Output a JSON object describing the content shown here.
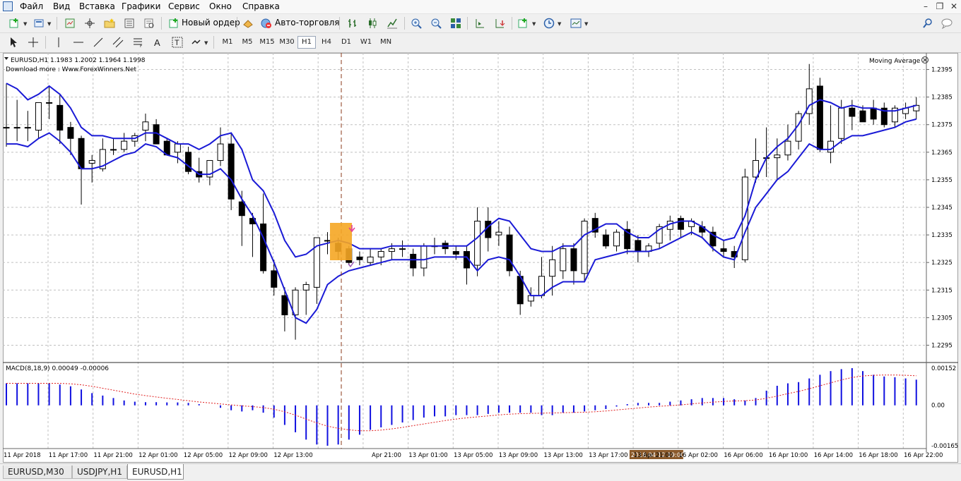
{
  "menu": {
    "items": [
      "Файл",
      "Вид",
      "Вставка",
      "Графики",
      "Сервис",
      "Окно",
      "Справка"
    ]
  },
  "toolbar": {
    "new_order_label": "Новый ордер",
    "auto_trading_label": "Авто-торговля"
  },
  "periods": [
    "M1",
    "M5",
    "M15",
    "M30",
    "H1",
    "H4",
    "D1",
    "W1",
    "MN"
  ],
  "active_period": "H1",
  "chart": {
    "header": "EURUSD,H1  1.1983 1.2002 1.1964 1.1998",
    "watermark": "Download more : Www.ForexWinners.Net",
    "indicator_label": "Moving Average",
    "price_labels": [
      "1.2395",
      "1.2385",
      "1.2375",
      "1.2365",
      "1.2355",
      "1.2345",
      "1.2335",
      "1.2325",
      "1.2315",
      "1.2305",
      "1.2295"
    ],
    "macd_label": "MACD(8,18,9) 0.00049 -0.00006",
    "macd_labels": [
      "0.00152",
      "0.00",
      "-0.00165"
    ],
    "time_labels": [
      "11 Apr 2018",
      "11 Apr 17:00",
      "11 Apr 21:00",
      "12 Apr 01:00",
      "12 Apr 05:00",
      "12 Apr 09:00",
      "12 Apr 13:00",
      "2018.04.12 19:00",
      "Apr 21:00",
      "13 Apr 01:00",
      "13 Apr 05:00",
      "13 Apr 09:00",
      "13 Apr 13:00",
      "13 Apr 17:00",
      "13 Apr 21:00",
      "16 Apr 02:00",
      "16 Apr 06:00",
      "16 Apr 10:00",
      "16 Apr 14:00",
      "16 Apr 18:00",
      "16 Apr 22:00"
    ],
    "highlighted_time": "2018.04.12 19:00",
    "colors": {
      "ma_line": "#1a1ad6",
      "macd_hist": "#1010e0",
      "macd_signal": "#e02020",
      "cursor_line": "#8b3a1a",
      "grid": "#c0c0c0",
      "signal_box": "#f5a623",
      "time_highlight_bg": "#8b5a2b"
    }
  },
  "chart_data": {
    "type": "candlestick",
    "symbol": "EURUSD",
    "timeframe": "H1",
    "ylim": [
      1.229,
      1.24
    ],
    "candles": [
      {
        "o": 1.2374,
        "h": 1.239,
        "l": 1.2367,
        "c": 1.2374
      },
      {
        "o": 1.2374,
        "h": 1.2384,
        "l": 1.2369,
        "c": 1.2374
      },
      {
        "o": 1.2374,
        "h": 1.238,
        "l": 1.2369,
        "c": 1.2374
      },
      {
        "o": 1.2373,
        "h": 1.2383,
        "l": 1.237,
        "c": 1.2383
      },
      {
        "o": 1.2383,
        "h": 1.2389,
        "l": 1.2377,
        "c": 1.2383
      },
      {
        "o": 1.2382,
        "h": 1.2386,
        "l": 1.2368,
        "c": 1.2373
      },
      {
        "o": 1.2374,
        "h": 1.2376,
        "l": 1.2364,
        "c": 1.237
      },
      {
        "o": 1.237,
        "h": 1.2371,
        "l": 1.2346,
        "c": 1.2359
      },
      {
        "o": 1.2361,
        "h": 1.2364,
        "l": 1.2354,
        "c": 1.2362
      },
      {
        "o": 1.2359,
        "h": 1.237,
        "l": 1.2358,
        "c": 1.2366
      },
      {
        "o": 1.2366,
        "h": 1.237,
        "l": 1.2364,
        "c": 1.2366
      },
      {
        "o": 1.2366,
        "h": 1.2372,
        "l": 1.2365,
        "c": 1.2369
      },
      {
        "o": 1.2369,
        "h": 1.2372,
        "l": 1.2367,
        "c": 1.2371
      },
      {
        "o": 1.2373,
        "h": 1.2379,
        "l": 1.2369,
        "c": 1.2376
      },
      {
        "o": 1.2375,
        "h": 1.2377,
        "l": 1.2368,
        "c": 1.2368
      },
      {
        "o": 1.2369,
        "h": 1.237,
        "l": 1.2364,
        "c": 1.2364
      },
      {
        "o": 1.2365,
        "h": 1.2369,
        "l": 1.2361,
        "c": 1.2368
      },
      {
        "o": 1.2365,
        "h": 1.2367,
        "l": 1.2357,
        "c": 1.2358
      },
      {
        "o": 1.2358,
        "h": 1.2363,
        "l": 1.2354,
        "c": 1.2356
      },
      {
        "o": 1.2356,
        "h": 1.2361,
        "l": 1.2353,
        "c": 1.2362
      },
      {
        "o": 1.2362,
        "h": 1.2374,
        "l": 1.236,
        "c": 1.2368
      },
      {
        "o": 1.2368,
        "h": 1.2372,
        "l": 1.2344,
        "c": 1.2348
      },
      {
        "o": 1.2347,
        "h": 1.2351,
        "l": 1.2331,
        "c": 1.2342
      },
      {
        "o": 1.2341,
        "h": 1.2343,
        "l": 1.2327,
        "c": 1.2339
      },
      {
        "o": 1.2339,
        "h": 1.235,
        "l": 1.2321,
        "c": 1.2322
      },
      {
        "o": 1.2322,
        "h": 1.2326,
        "l": 1.2313,
        "c": 1.2316
      },
      {
        "o": 1.2313,
        "h": 1.2316,
        "l": 1.23,
        "c": 1.2306
      },
      {
        "o": 1.2306,
        "h": 1.2316,
        "l": 1.2297,
        "c": 1.2315
      },
      {
        "o": 1.2315,
        "h": 1.2318,
        "l": 1.2306,
        "c": 1.2317
      },
      {
        "o": 1.2316,
        "h": 1.2328,
        "l": 1.231,
        "c": 1.2334
      },
      {
        "o": 1.2333,
        "h": 1.2336,
        "l": 1.2328,
        "c": 1.2333
      },
      {
        "o": 1.2332,
        "h": 1.2334,
        "l": 1.2326,
        "c": 1.2329
      },
      {
        "o": 1.233,
        "h": 1.2331,
        "l": 1.2324,
        "c": 1.2325
      },
      {
        "o": 1.2327,
        "h": 1.2329,
        "l": 1.2324,
        "c": 1.2326
      },
      {
        "o": 1.2325,
        "h": 1.233,
        "l": 1.2324,
        "c": 1.2327
      },
      {
        "o": 1.2327,
        "h": 1.233,
        "l": 1.2324,
        "c": 1.2329
      },
      {
        "o": 1.2329,
        "h": 1.2332,
        "l": 1.2326,
        "c": 1.233
      },
      {
        "o": 1.233,
        "h": 1.2333,
        "l": 1.2327,
        "c": 1.233
      },
      {
        "o": 1.2328,
        "h": 1.233,
        "l": 1.232,
        "c": 1.2323
      },
      {
        "o": 1.2323,
        "h": 1.2332,
        "l": 1.232,
        "c": 1.2331
      },
      {
        "o": 1.2331,
        "h": 1.2334,
        "l": 1.2328,
        "c": 1.2331
      },
      {
        "o": 1.2332,
        "h": 1.2333,
        "l": 1.2328,
        "c": 1.233
      },
      {
        "o": 1.2329,
        "h": 1.2331,
        "l": 1.2326,
        "c": 1.2328
      },
      {
        "o": 1.2329,
        "h": 1.2331,
        "l": 1.2317,
        "c": 1.2323
      },
      {
        "o": 1.2324,
        "h": 1.2345,
        "l": 1.232,
        "c": 1.234
      },
      {
        "o": 1.234,
        "h": 1.2345,
        "l": 1.2329,
        "c": 1.2334
      },
      {
        "o": 1.2335,
        "h": 1.234,
        "l": 1.2331,
        "c": 1.2336
      },
      {
        "o": 1.2335,
        "h": 1.2338,
        "l": 1.232,
        "c": 1.2322
      },
      {
        "o": 1.232,
        "h": 1.2322,
        "l": 1.2306,
        "c": 1.231
      },
      {
        "o": 1.2311,
        "h": 1.2316,
        "l": 1.2309,
        "c": 1.2313
      },
      {
        "o": 1.2313,
        "h": 1.2327,
        "l": 1.2312,
        "c": 1.232
      },
      {
        "o": 1.232,
        "h": 1.2331,
        "l": 1.2313,
        "c": 1.2326
      },
      {
        "o": 1.2322,
        "h": 1.2332,
        "l": 1.2319,
        "c": 1.233
      },
      {
        "o": 1.233,
        "h": 1.2332,
        "l": 1.2317,
        "c": 1.2322
      },
      {
        "o": 1.2321,
        "h": 1.2341,
        "l": 1.2318,
        "c": 1.234
      },
      {
        "o": 1.2341,
        "h": 1.2343,
        "l": 1.2334,
        "c": 1.2336
      },
      {
        "o": 1.2335,
        "h": 1.2337,
        "l": 1.233,
        "c": 1.2331
      },
      {
        "o": 1.2331,
        "h": 1.2337,
        "l": 1.2329,
        "c": 1.2336
      },
      {
        "o": 1.2337,
        "h": 1.234,
        "l": 1.2328,
        "c": 1.233
      },
      {
        "o": 1.2333,
        "h": 1.2335,
        "l": 1.2325,
        "c": 1.2329
      },
      {
        "o": 1.2329,
        "h": 1.2332,
        "l": 1.2327,
        "c": 1.2331
      },
      {
        "o": 1.2332,
        "h": 1.2339,
        "l": 1.233,
        "c": 1.2338
      },
      {
        "o": 1.2337,
        "h": 1.2342,
        "l": 1.2333,
        "c": 1.234
      },
      {
        "o": 1.2341,
        "h": 1.2342,
        "l": 1.2334,
        "c": 1.2337
      },
      {
        "o": 1.2338,
        "h": 1.2341,
        "l": 1.2335,
        "c": 1.234
      },
      {
        "o": 1.2338,
        "h": 1.234,
        "l": 1.2334,
        "c": 1.2336
      },
      {
        "o": 1.2336,
        "h": 1.2338,
        "l": 1.2329,
        "c": 1.2331
      },
      {
        "o": 1.233,
        "h": 1.2333,
        "l": 1.2327,
        "c": 1.2329
      },
      {
        "o": 1.2329,
        "h": 1.2331,
        "l": 1.2323,
        "c": 1.2327
      },
      {
        "o": 1.2326,
        "h": 1.2359,
        "l": 1.2325,
        "c": 1.2356
      },
      {
        "o": 1.2356,
        "h": 1.237,
        "l": 1.2354,
        "c": 1.2362
      },
      {
        "o": 1.2363,
        "h": 1.2374,
        "l": 1.2356,
        "c": 1.2363
      },
      {
        "o": 1.2363,
        "h": 1.237,
        "l": 1.2355,
        "c": 1.2364
      },
      {
        "o": 1.2364,
        "h": 1.2375,
        "l": 1.2362,
        "c": 1.2369
      },
      {
        "o": 1.2369,
        "h": 1.238,
        "l": 1.2366,
        "c": 1.2379
      },
      {
        "o": 1.2379,
        "h": 1.2397,
        "l": 1.2375,
        "c": 1.2388
      },
      {
        "o": 1.2389,
        "h": 1.2392,
        "l": 1.2365,
        "c": 1.2366
      },
      {
        "o": 1.2365,
        "h": 1.2382,
        "l": 1.2361,
        "c": 1.2369
      },
      {
        "o": 1.237,
        "h": 1.2384,
        "l": 1.2368,
        "c": 1.2381
      },
      {
        "o": 1.2381,
        "h": 1.2384,
        "l": 1.2373,
        "c": 1.2378
      },
      {
        "o": 1.238,
        "h": 1.2382,
        "l": 1.2376,
        "c": 1.2376
      },
      {
        "o": 1.2381,
        "h": 1.2384,
        "l": 1.2375,
        "c": 1.2377
      },
      {
        "o": 1.2381,
        "h": 1.2383,
        "l": 1.2374,
        "c": 1.2375
      },
      {
        "o": 1.2376,
        "h": 1.2382,
        "l": 1.2374,
        "c": 1.2381
      },
      {
        "o": 1.2379,
        "h": 1.2383,
        "l": 1.2377,
        "c": 1.2381
      },
      {
        "o": 1.238,
        "h": 1.2385,
        "l": 1.2377,
        "c": 1.2382
      }
    ],
    "ma_upper": [
      1.239,
      1.2388,
      1.2384,
      1.2386,
      1.2389,
      1.2386,
      1.2381,
      1.2374,
      1.2371,
      1.2371,
      1.237,
      1.237,
      1.237,
      1.2372,
      1.2372,
      1.237,
      1.2368,
      1.2368,
      1.2366,
      1.2368,
      1.2371,
      1.2372,
      1.2366,
      1.2355,
      1.2351,
      1.2343,
      1.2333,
      1.2327,
      1.2328,
      1.2331,
      1.2332,
      1.2333,
      1.2332,
      1.233,
      1.233,
      1.233,
      1.2331,
      1.2331,
      1.2331,
      1.2331,
      1.2331,
      1.2331,
      1.2331,
      1.2331,
      1.2334,
      1.2338,
      1.2341,
      1.234,
      1.2335,
      1.233,
      1.2329,
      1.2329,
      1.2331,
      1.2331,
      1.2335,
      1.2337,
      1.2339,
      1.2339,
      1.2336,
      1.2334,
      1.2334,
      1.2337,
      1.2339,
      1.234,
      1.234,
      1.2338,
      1.2335,
      1.2333,
      1.2334,
      1.2342,
      1.2355,
      1.2363,
      1.2367,
      1.237,
      1.2375,
      1.2382,
      1.2384,
      1.2383,
      1.2381,
      1.2382,
      1.2381,
      1.2381,
      1.238,
      1.238,
      1.2381,
      1.2382
    ],
    "ma_lower": [
      1.2368,
      1.2368,
      1.2367,
      1.237,
      1.2372,
      1.2369,
      1.2365,
      1.2359,
      1.2359,
      1.236,
      1.2362,
      1.2364,
      1.2365,
      1.2368,
      1.2367,
      1.2364,
      1.2363,
      1.236,
      1.2357,
      1.2357,
      1.2359,
      1.2355,
      1.2348,
      1.2342,
      1.2334,
      1.2325,
      1.2315,
      1.2305,
      1.2303,
      1.2308,
      1.2317,
      1.232,
      1.2322,
      1.2323,
      1.2324,
      1.2325,
      1.2326,
      1.2326,
      1.2326,
      1.2326,
      1.2327,
      1.2327,
      1.2327,
      1.2327,
      1.2322,
      1.2326,
      1.2327,
      1.2326,
      1.232,
      1.2313,
      1.2313,
      1.2316,
      1.2318,
      1.2318,
      1.2318,
      1.2326,
      1.2327,
      1.2328,
      1.2329,
      1.2329,
      1.2329,
      1.233,
      1.2332,
      1.2334,
      1.2336,
      1.2334,
      1.233,
      1.2327,
      1.2326,
      1.2336,
      1.2345,
      1.235,
      1.2355,
      1.2358,
      1.2363,
      1.2368,
      1.2366,
      1.2366,
      1.2369,
      1.2371,
      1.2371,
      1.2372,
      1.2373,
      1.2374,
      1.2376,
      1.2377
    ],
    "macd_range": [
      -0.00165,
      0.00152
    ],
    "macd_hist": [
      0.0009,
      0.0009,
      0.0009,
      0.0009,
      0.0009,
      0.00085,
      0.00078,
      0.00065,
      0.0005,
      0.0004,
      0.0003,
      0.0002,
      0.00015,
      0.00013,
      0.00013,
      0.00012,
      0.00012,
      0.0001,
      5e-05,
      0.0,
      -0.0001,
      -0.0002,
      -0.00025,
      -0.0002,
      -0.0003,
      -0.0005,
      -0.0008,
      -0.0011,
      -0.0014,
      -0.0016,
      -0.00165,
      -0.0016,
      -0.0014,
      -0.0012,
      -0.001,
      -0.0009,
      -0.0008,
      -0.0007,
      -0.0006,
      -0.0005,
      -0.00045,
      -0.00045,
      -0.0004,
      -0.0004,
      -0.0004,
      -0.00035,
      -0.0003,
      -0.0003,
      -0.0003,
      -0.0003,
      -0.0004,
      -0.0004,
      -0.0003,
      -0.0003,
      -0.00025,
      -0.0002,
      -0.00015,
      -5e-05,
      5e-05,
      0.0001,
      0.0001,
      0.0001,
      0.00015,
      0.0002,
      0.00025,
      0.0003,
      0.0003,
      0.0003,
      0.00025,
      0.0002,
      0.0003,
      0.0006,
      0.0008,
      0.0009,
      0.00095,
      0.0011,
      0.00125,
      0.0014,
      0.00148,
      0.00152,
      0.0014,
      0.00125,
      0.00118,
      0.00115,
      0.0011,
      0.00105
    ],
    "macd_signal": [
      0.0009,
      0.0009,
      0.0009,
      0.0009,
      0.0009,
      0.0009,
      0.00088,
      0.00084,
      0.00078,
      0.0007,
      0.00062,
      0.00054,
      0.00046,
      0.0004,
      0.00034,
      0.00029,
      0.00024,
      0.00019,
      0.00014,
      0.0001,
      6e-05,
      2e-05,
      -2e-05,
      -5e-05,
      -9e-05,
      -0.00016,
      -0.00026,
      -0.0004,
      -0.00056,
      -0.00072,
      -0.00085,
      -0.00094,
      -0.001,
      -0.00104,
      -0.00104,
      -0.00101,
      -0.00096,
      -0.0009,
      -0.00083,
      -0.00076,
      -0.00069,
      -0.00062,
      -0.00056,
      -0.00051,
      -0.00047,
      -0.00043,
      -0.00039,
      -0.00036,
      -0.00034,
      -0.00033,
      -0.00032,
      -0.00031,
      -0.0003,
      -0.00029,
      -0.00028,
      -0.00026,
      -0.00023,
      -0.00019,
      -0.00015,
      -0.00011,
      -7e-05,
      -4e-05,
      -1e-05,
      2e-05,
      6e-05,
      0.0001,
      0.00013,
      0.00016,
      0.00018,
      0.00019,
      0.00022,
      0.00029,
      0.00038,
      0.00048,
      0.00057,
      0.00068,
      0.0008,
      0.00092,
      0.00104,
      0.00114,
      0.0012,
      0.00123,
      0.00124,
      0.00124,
      0.00123,
      0.00121
    ]
  }
}
